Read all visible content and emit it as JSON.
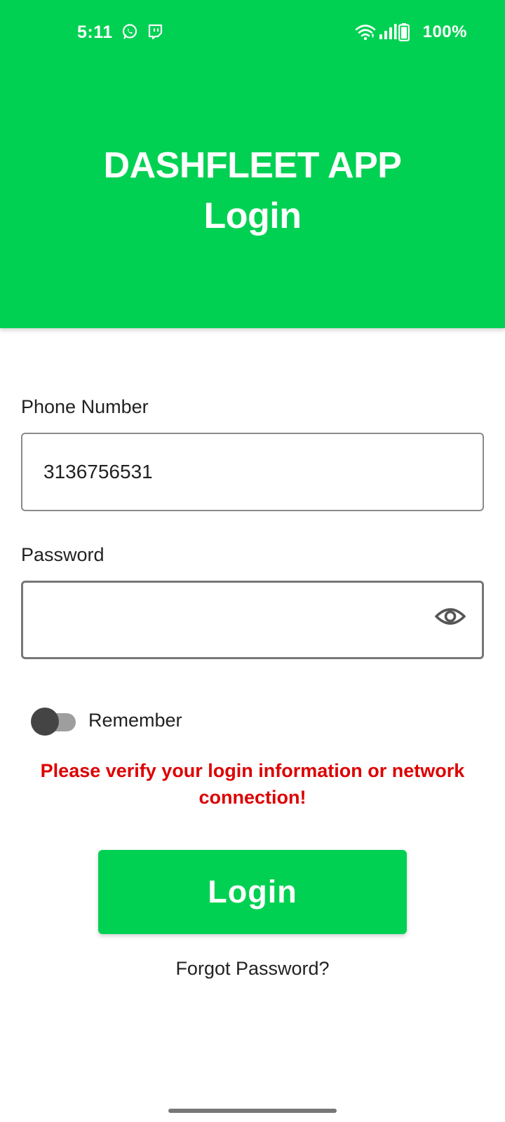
{
  "status_bar": {
    "time": "5:11",
    "left_icons": [
      "whatsapp-icon",
      "twitch-icon"
    ],
    "right_icons": [
      "wifi-icon",
      "signal-icon",
      "battery-icon"
    ],
    "battery_percent": "100%"
  },
  "header": {
    "title_line1": "DASHFLEET APP",
    "title_line2": "Login",
    "background_color": "#00d152"
  },
  "form": {
    "phone_label": "Phone Number",
    "phone_value": "3136756531",
    "password_label": "Password",
    "password_value": "",
    "password_toggle_icon": "eye-icon",
    "remember_label": "Remember",
    "remember_checked": false,
    "error_message": "Please verify your login information or network connection!",
    "error_color": "#dd0000"
  },
  "actions": {
    "login_label": "Login",
    "forgot_label": "Forgot Password?",
    "accent_color": "#00d152"
  }
}
